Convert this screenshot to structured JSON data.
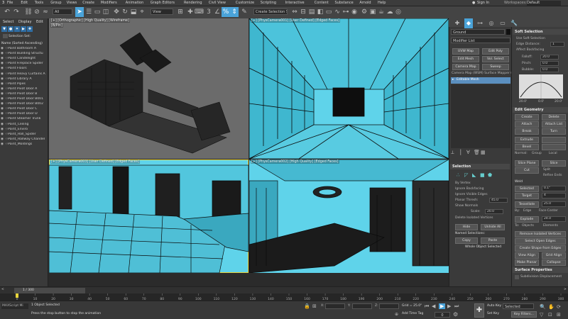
{
  "menu": {
    "items": [
      "File",
      "Edit",
      "Tools",
      "Group",
      "Views",
      "Create",
      "Modifiers",
      "Animation",
      "Graph Editors",
      "Rendering",
      "Civil View",
      "Customize",
      "Scripting",
      "Interactive",
      "Content",
      "Substance",
      "Arnold",
      "Help"
    ],
    "signin": "Sign In",
    "workspaces_label": "Workspaces:",
    "workspaces_value": "Default"
  },
  "toolbar": {
    "filter_value": "All",
    "view_value": "View",
    "create_selection_set": "Create Selection Se",
    "accent": "#4aa3d9"
  },
  "scene": {
    "tabs": [
      "Select",
      "Display",
      "Edit"
    ],
    "selection_set": "Selection Set:",
    "header": "Name (Sorted Ascending)",
    "items": [
      "Point Bathroom A",
      "Point Building Structu",
      "Point Candlelight",
      "Point Fireplace Spider",
      "Point Floors",
      "Point Heavy Curtains A",
      "Point Library A",
      "Point Pipes",
      "Point Pivot Door A",
      "Point Pivot Door B",
      "Point Pivot Door B001",
      "Point Pivot Door B002",
      "Point Pivot Door C",
      "Point Pivot Door D",
      "Point Steamer Trunk",
      "Point_Ceiling",
      "Point_Enviro",
      "Point_Hall_Spider",
      "Point_Hallway Chandel",
      "Point_Moldings"
    ]
  },
  "viewports": {
    "top_left": "[+] [Orthographic] [High Quality] [Wireframe]",
    "top_left_sub": "[B/Pin]",
    "top_right": "[+] [PhysCamera001] [User Defined] [Edged Faces]",
    "bottom_left": "[+] [PhysCamera003] [User Defined] [Edged Faces]",
    "bottom_right": "[+] [PhysCamera002] [High Quality] [Edged Faces]",
    "wire_color": "#5fd3ea"
  },
  "command_panel": {
    "object_name": "Ground",
    "modifier_list": "Modifier List",
    "buttons": [
      "UVW Map",
      "Edit Poly",
      "Edit Mesh",
      "Vol. Select",
      "Camera Map",
      "Sweep"
    ],
    "stack_header": "Camera Map (WSM)  Surface Mapper (W",
    "stack_selected": "Editable Mesh",
    "selection_title": "Selection",
    "selection_opts": [
      "By Vertex",
      "Ignore Backfacing",
      "Ignore Visible Edges",
      "Planar Thresh:",
      "Show Normals",
      "Scale:",
      "Delete Isolated Vertices"
    ],
    "planar_value": "45.0",
    "scale_value": "20.0",
    "hide": "Hide",
    "unhide_all": "Unhide All",
    "named_selections": "Named Selections:",
    "copy": "Copy",
    "paste": "Paste",
    "selected_status": "Whole Object Selected"
  },
  "soft_selection": {
    "title": "Soft Selection",
    "opts": [
      "Use Soft Selection",
      "Edge Distance:",
      "Affect Backfacing"
    ],
    "edge_dist": "1",
    "falloff_label": "Falloff:",
    "falloff": "20.0",
    "pinch_label": "Pinch:",
    "pinch": "0.0",
    "bubble_label": "Bubble:",
    "bubble": "0.0",
    "curve_ticks": [
      "20.0'",
      "0.0'",
      "20.0'"
    ]
  },
  "edit_geometry": {
    "title": "Edit Geometry",
    "create": "Create",
    "delete": "Delete",
    "attach": "Attach",
    "attach_list": "Attach List",
    "break": "Break",
    "turn": "Turn",
    "extrude": "Extrude",
    "bevel": "Bevel",
    "normal": "Normal:",
    "group": "Group",
    "local": "Local",
    "slice_plane": "Slice Plane",
    "slice": "Slice",
    "cut": "Cut",
    "split": "Split",
    "refine_ends": "Refine Ends",
    "weld": "Weld",
    "selected": "Selected",
    "selected_val": "0.1\"",
    "target": "Target",
    "target_val": "4",
    "tessellate": "Tessellate",
    "tess_val": "25.0",
    "by_label": "By:",
    "edge": "Edge",
    "face_center": "Face-Center",
    "explode": "Explode",
    "explode_val": "24.0",
    "to": "To:",
    "objects": "Objects",
    "elements": "Elements",
    "remove_isolated": "Remove Isolated Vertices",
    "select_open": "Select Open Edges",
    "create_shape": "Create Shape from Edges",
    "view_align": "View Align",
    "grid_align": "Grid Align",
    "make_planar": "Make Planar",
    "collapse": "Collapse"
  },
  "surface": {
    "title": "Surface Properties",
    "subdiv": "Subdivision Displacement"
  },
  "timeline": {
    "frame": "1 / 300",
    "ticks": [
      "0",
      "10",
      "20",
      "30",
      "40",
      "50",
      "60",
      "70",
      "80",
      "90",
      "100",
      "110",
      "120",
      "130",
      "140",
      "150",
      "160",
      "170",
      "180",
      "190",
      "200",
      "210",
      "220",
      "230",
      "240",
      "250",
      "260",
      "270",
      "280",
      "290",
      "300"
    ]
  },
  "status": {
    "maxscript": "MAXScript Mi",
    "selected": "1 Object Selected",
    "prompt": "Press the stop button to stop the animation",
    "x_label": "X:",
    "y_label": "Y:",
    "z_label": "Z:",
    "grid": "Grid = 25.0\"",
    "add_time_tag": "Add Time Tag",
    "auto_key": "Auto Key",
    "set_key": "Set Key",
    "selected_dd": "Selected",
    "key_filters": "Key Filters...",
    "frame_num": "0"
  }
}
